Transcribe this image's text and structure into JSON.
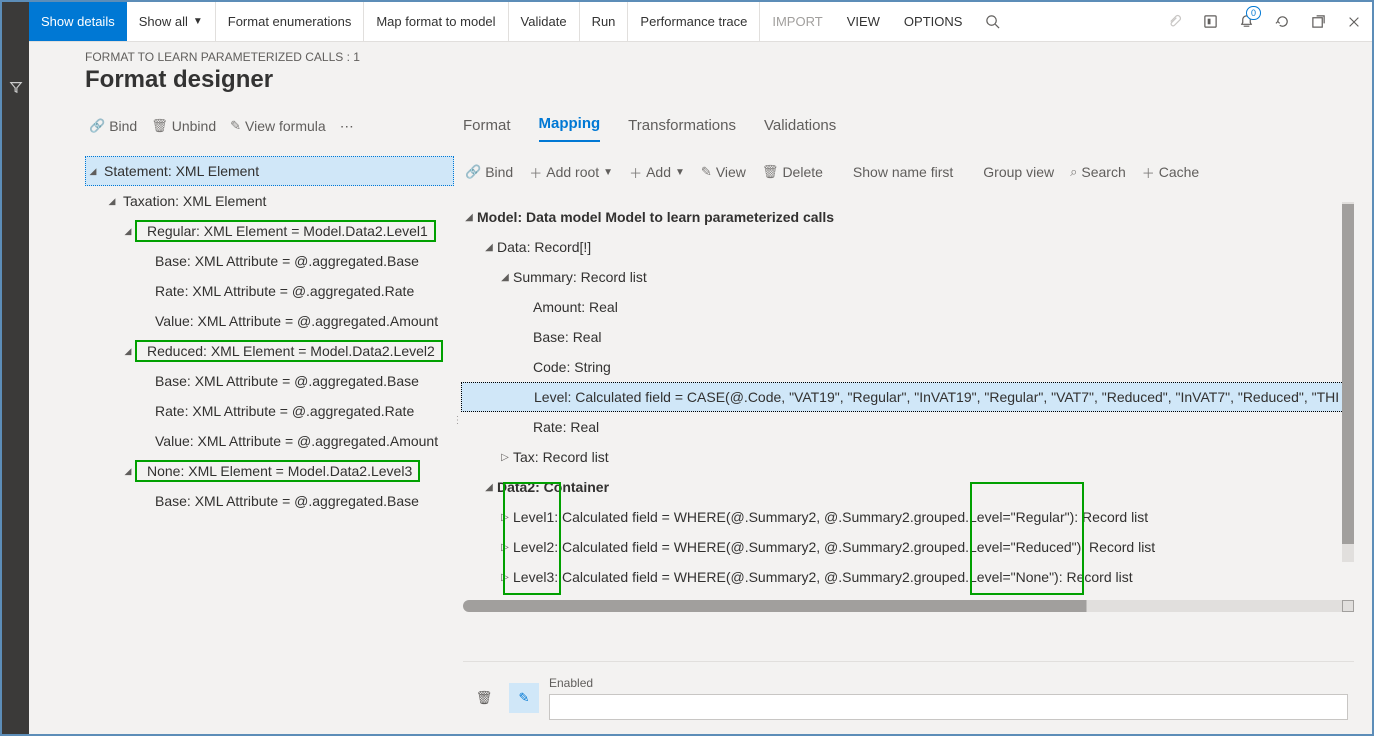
{
  "topbar": {
    "show_details": "Show details",
    "show_all": "Show all",
    "format_enum": "Format enumerations",
    "map_format": "Map format to model",
    "validate": "Validate",
    "run": "Run",
    "perf_trace": "Performance trace",
    "import": "IMPORT",
    "view": "VIEW",
    "options": "OPTIONS",
    "badge_count": "0"
  },
  "crumb": "FORMAT TO LEARN PARAMETERIZED CALLS : 1",
  "page_title": "Format designer",
  "left_toolbar": {
    "bind": "Bind",
    "unbind": "Unbind",
    "view_formula": "View formula"
  },
  "left_tree": {
    "r0": "Statement: XML Element",
    "r1": "Taxation: XML Element",
    "r2": "Regular: XML Element = Model.Data2.Level1",
    "r3": "Base: XML Attribute = @.aggregated.Base",
    "r4": "Rate: XML Attribute = @.aggregated.Rate",
    "r5": "Value: XML Attribute = @.aggregated.Amount",
    "r6": "Reduced: XML Element = Model.Data2.Level2",
    "r7": "Base: XML Attribute = @.aggregated.Base",
    "r8": "Rate: XML Attribute = @.aggregated.Rate",
    "r9": "Value: XML Attribute = @.aggregated.Amount",
    "r10": "None: XML Element = Model.Data2.Level3",
    "r11": "Base: XML Attribute = @.aggregated.Base"
  },
  "tabs": {
    "format": "Format",
    "mapping": "Mapping",
    "transformations": "Transformations",
    "validations": "Validations"
  },
  "right_toolbar": {
    "bind": "Bind",
    "add_root": "Add root",
    "add": "Add",
    "view": "View",
    "delete": "Delete",
    "show_name": "Show name first",
    "group_view": "Group view",
    "search": "Search",
    "cache": "Cache"
  },
  "model_tree": {
    "m0": "Model: Data model Model to learn parameterized calls",
    "m1": "Data: Record[!]",
    "m2": "Summary: Record list",
    "m3": "Amount: Real",
    "m4": "Base: Real",
    "m5": "Code: String",
    "m6": "Level: Calculated field = CASE(@.Code, \"VAT19\", \"Regular\", \"InVAT19\", \"Regular\", \"VAT7\", \"Reduced\", \"InVAT7\", \"Reduced\", \"THI",
    "m7": "Rate: Real",
    "m8": "Tax: Record list",
    "m9": "Data2: Container",
    "m10": "Level1: Calculated field = WHERE(@.Summary2, @.Summary2.grouped.Level=\"Regular\"): Record list",
    "m11": "Level2: Calculated field = WHERE(@.Summary2, @.Summary2.grouped.Level=\"Reduced\"): Record list",
    "m12": "Level3: Calculated field = WHERE(@.Summary2, @.Summary2.grouped.Level=\"None\"): Record list"
  },
  "bottom": {
    "enabled_label": "Enabled"
  }
}
